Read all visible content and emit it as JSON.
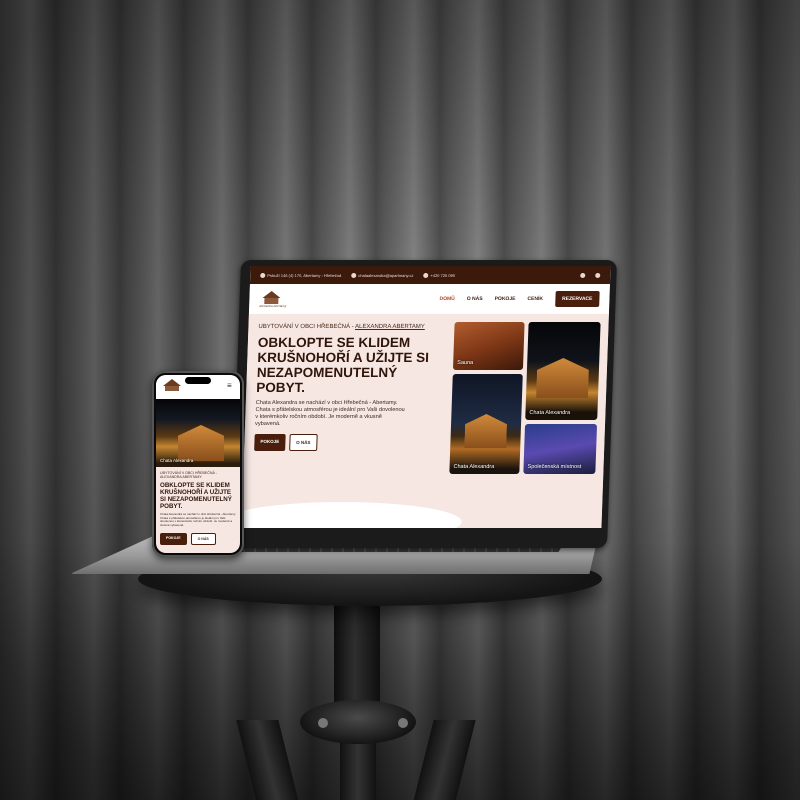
{
  "site": {
    "topbar": {
      "address": "Pstruží 146 (4) 170, Abertamy - Hřebečná",
      "email": "chataalexandra@apartmany.cz",
      "phone": "+420 725 090"
    },
    "logo_text": "Alexandra Abertamy",
    "nav": {
      "items": [
        "DOMŮ",
        "O NÁS",
        "POKOJE",
        "CENÍK"
      ],
      "reserve": "REZERVACE"
    },
    "hero": {
      "kicker_prefix": "UBYTOVÁNÍ V OBCI HŘEBEČNÁ - ",
      "kicker_link": "ALEXANDRA ABERTAMY",
      "title": "OBKLOPTE SE KLIDEM KRUŠNOHOŘÍ A UŽIJTE SI NEZAPOMENUTELNÝ POBYT.",
      "description": "Chata Alexandra se nachází v obci Hřebečná - Abertamy. Chata s přátelskou atmosférou je ideální pro Vaši dovolenou v kterémkoliv ročním období. Je moderně a vkusně vybavená.",
      "button_primary": "POKOJE",
      "button_secondary": "O NÁS"
    },
    "gallery": [
      {
        "label": "Sauna"
      },
      {
        "label": "Chata Alexandra"
      },
      {
        "label": "Chata Alexandra"
      },
      {
        "label": "Společenská místnost"
      }
    ]
  },
  "phone": {
    "image_label": "Chata Alexandra",
    "kicker": "UBYTOVÁNÍ V OBCI HŘEBEČNÁ - ALEXANDRA ABERTAMY",
    "title": "OBKLOPTE SE KLIDEM KRUŠNOHOŘÍ A UŽIJTE SI NEZAPOMENUTELNÝ POBYT.",
    "description": "Chata Alexandra se nachází v obci Hřebečná - Abertamy. Chata s přátelskou atmosférou je ideální pro Vaši dovolenou v kterémkoliv ročním období. Je moderně a vkusně vybavená.",
    "button_primary": "POKOJE",
    "button_secondary": "O NÁS",
    "menu_icon": "hamburger-menu-icon"
  },
  "colors": {
    "brand_dark": "#4a1e0c",
    "topbar": "#3b1a0c",
    "hero_bg": "#f6e7e3",
    "accent_active": "#b2452a"
  }
}
